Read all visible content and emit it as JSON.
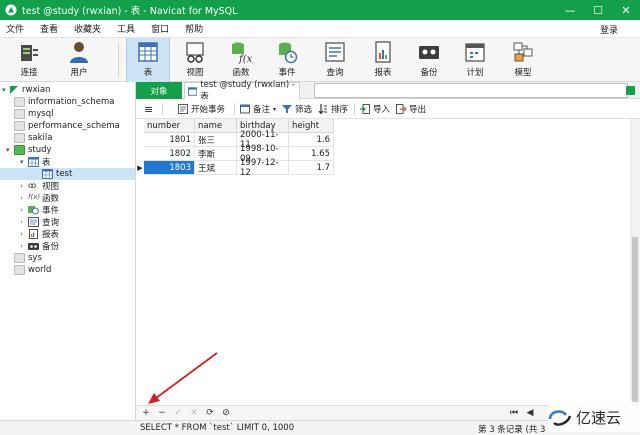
{
  "window": {
    "title": "test @study (rwxian) - 表 - Navicat for MySQL",
    "minimize": "—",
    "maximize": "☐",
    "close": "✕"
  },
  "menu": {
    "items": [
      "文件",
      "查看",
      "收藏夹",
      "工具",
      "窗口",
      "帮助"
    ],
    "login": "登录"
  },
  "toolbar": {
    "buttons": [
      "连接",
      "用户",
      "表",
      "视图",
      "函数",
      "事件",
      "查询",
      "报表",
      "备份",
      "计划",
      "模型"
    ]
  },
  "sidebar": {
    "connection": "rwxian",
    "databases": [
      "information_schema",
      "mysql",
      "performance_schema",
      "sakila"
    ],
    "open_db": "study",
    "tables_group": "表",
    "table": "test",
    "groups": [
      "视图",
      "函数",
      "事件",
      "查询",
      "报表",
      "备份"
    ],
    "more_dbs": [
      "sys",
      "world"
    ]
  },
  "tabs": {
    "objects": "对象",
    "active": "test @study (rwxian) - 表"
  },
  "subtoolbar": {
    "menu": "≡",
    "begin_tx": "开始事务",
    "memo": "备注",
    "filter": "筛选",
    "sort": "排序",
    "import": "导入",
    "export": "导出"
  },
  "grid": {
    "columns": [
      "number",
      "name",
      "birthday",
      "height"
    ],
    "rows": [
      [
        "1801",
        "张三",
        "2000-11-11",
        "1.6"
      ],
      [
        "1802",
        "李斯",
        "1998-10-09",
        "1.65"
      ],
      [
        "1803",
        "王斌",
        "1997-12-12",
        "1.7"
      ]
    ],
    "selected_row": 2
  },
  "navbar": {
    "add": "+",
    "remove": "−",
    "apply": "✓",
    "discard": "✕",
    "refresh": "⟳",
    "stop": "⊘",
    "first": "⏮",
    "prev": "◀"
  },
  "status": {
    "sql": "SELECT * FROM `test` LIMIT 0, 1000",
    "records": "第 3 条记录 (共 3"
  },
  "watermark": {
    "text": "亿速云"
  },
  "colors": {
    "accent": "#12a04a",
    "selection": "#1e78d4",
    "annotation_arrow": "#d42020"
  }
}
